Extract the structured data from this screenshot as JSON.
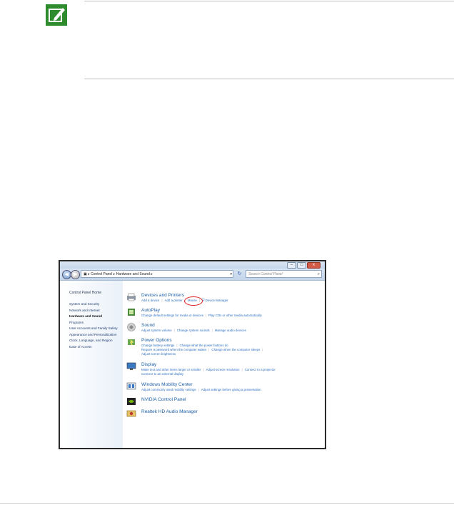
{
  "window": {
    "address": [
      "Control Panel",
      "Hardware and Sound"
    ],
    "search_placeholder": "Search Control Panel",
    "buttons": {
      "minimize": "–",
      "maximize": "□",
      "close": "x"
    }
  },
  "sidebar": {
    "title": "Control Panel Home",
    "items": [
      {
        "label": "System and Security",
        "active": false
      },
      {
        "label": "Network and Internet",
        "active": false
      },
      {
        "label": "Hardware and Sound",
        "active": true
      },
      {
        "label": "Programs",
        "active": false
      },
      {
        "label": "User Accounts and Family Safety",
        "active": false
      },
      {
        "label": "Appearance and Personalization",
        "active": false
      },
      {
        "label": "Clock, Language, and Region",
        "active": false
      },
      {
        "label": "Ease of Access",
        "active": false
      }
    ]
  },
  "sections": {
    "devices": {
      "title": "Devices and Printers",
      "links": [
        "Add a device",
        "Add a printer",
        "Mouse",
        "Device Manager"
      ]
    },
    "autoplay": {
      "title": "AutoPlay",
      "links": [
        "Change default settings for media or devices",
        "Play CDs or other media automatically"
      ]
    },
    "sound": {
      "title": "Sound",
      "links": [
        "Adjust system volume",
        "Change system sounds",
        "Manage audio devices"
      ]
    },
    "power": {
      "title": "Power Options",
      "links": [
        "Change battery settings",
        "Change what the power buttons do",
        "Require a password when the computer wakes",
        "Change when the computer sleeps",
        "Adjust screen brightness"
      ]
    },
    "display": {
      "title": "Display",
      "links": [
        "Make text and other items larger or smaller",
        "Adjust screen resolution",
        "Connect to a projector",
        "Connect to an external display"
      ]
    },
    "mobility": {
      "title": "Windows Mobility Center",
      "links": [
        "Adjust commonly used mobility settings",
        "Adjust settings before giving a presentation"
      ]
    },
    "nvidia": {
      "title": "NVIDIA Control Panel"
    },
    "realtek": {
      "title": "Realtek HD Audio Manager"
    }
  },
  "colors": {
    "link": "#2b6fc0",
    "heading": "#1d5fa8",
    "highlight": "#dd2222",
    "note_icon": "#2e8b2e"
  }
}
